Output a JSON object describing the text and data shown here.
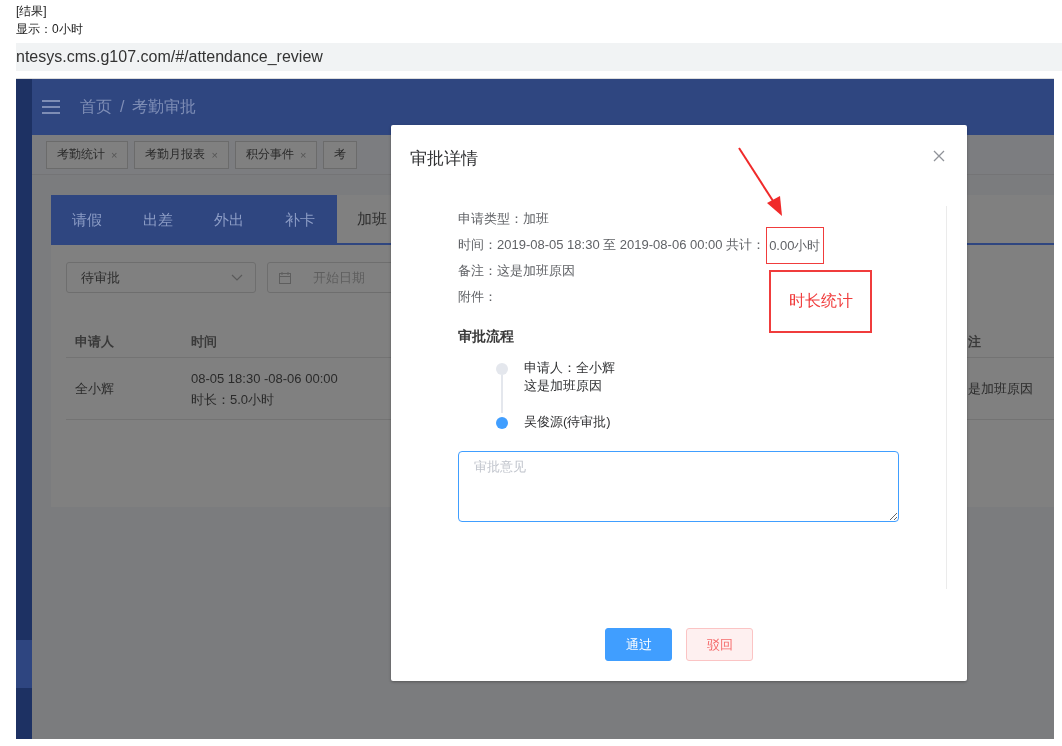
{
  "note": {
    "lines": [
      "[结果]",
      "显示：0小时"
    ]
  },
  "address_bar": {
    "url": "ntesys.cms.g107.com/#/attendance_review"
  },
  "app": {
    "breadcrumb": [
      "首页",
      "考勤审批"
    ],
    "breadcrumb_separator": "/",
    "tags": [
      {
        "label": "考勤统计",
        "close": "×"
      },
      {
        "label": "考勤月报表",
        "close": "×"
      },
      {
        "label": "积分事件",
        "close": "×"
      },
      {
        "label": "考"
      }
    ],
    "tabs": [
      {
        "label": "请假",
        "selected": false
      },
      {
        "label": "出差",
        "selected": false
      },
      {
        "label": "外出",
        "selected": false
      },
      {
        "label": "补卡",
        "selected": false
      },
      {
        "label": "加班",
        "selected": true
      }
    ],
    "filters": {
      "status": {
        "value": "待审批"
      },
      "start_date": {
        "placeholder": "开始日期"
      }
    },
    "table": {
      "columns": [
        "申请人",
        "时间",
        "注"
      ],
      "rows": [
        {
          "cells": [
            [
              "全小辉"
            ],
            [
              "08-05 18:30 -08-06 00:00",
              "时长：5.0小时"
            ],
            [
              "是加班原因"
            ]
          ]
        }
      ]
    }
  },
  "dialog": {
    "title": "审批详情",
    "details": [
      {
        "kind": "text",
        "text": "申请类型：加班"
      },
      {
        "kind": "duration",
        "text": "时间：2019-08-05 18:30 至 2019-08-06 00:00 共计：",
        "value": "0.00小时"
      },
      {
        "kind": "text",
        "text": "备注：这是加班原因"
      },
      {
        "kind": "text",
        "text": "附件："
      }
    ],
    "flow_title": "审批流程",
    "flow": [
      {
        "lines": [
          "申请人：全小辉",
          "这是加班原因"
        ],
        "current": false
      },
      {
        "lines": [
          "吴俊源(待审批)"
        ],
        "current": true
      }
    ],
    "comment": {
      "placeholder": "审批意见"
    },
    "buttons": [
      {
        "label": "通过",
        "kind": "primary"
      },
      {
        "label": "驳回",
        "kind": "danger"
      }
    ]
  },
  "annotation": {
    "label": "时长统计"
  }
}
